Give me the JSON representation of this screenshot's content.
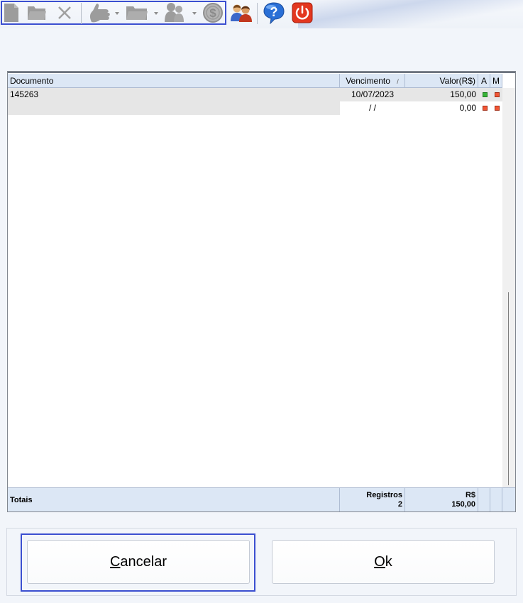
{
  "toolbar": {
    "icons": [
      "new-document-icon",
      "open-folder-icon",
      "delete-icon",
      "hand-icon",
      "folder-dropdown-icon",
      "people-search-icon",
      "money-icon",
      "users-icon",
      "help-icon",
      "power-icon"
    ]
  },
  "grid": {
    "columns": [
      "Documento",
      "Vencimento",
      "Valor(R$)",
      "A",
      "M"
    ],
    "sort_indicator": "/",
    "rows": [
      {
        "documento": "145263",
        "vencimento": "10/07/2023",
        "valor": "150,00"
      },
      {
        "documento": "",
        "vencimento": "/ /",
        "valor": "0,00"
      }
    ],
    "status_colors": {
      "green": "#37b337",
      "red": "#f05535"
    },
    "footer": {
      "totais_label": "Totais",
      "registros_label": "Registros",
      "registros_value": "2",
      "valor_label": "R$",
      "valor_value": "150,00"
    }
  },
  "buttons": {
    "cancel_accel": "C",
    "cancel_rest": "ancelar",
    "ok_accel": "O",
    "ok_rest": "k"
  }
}
